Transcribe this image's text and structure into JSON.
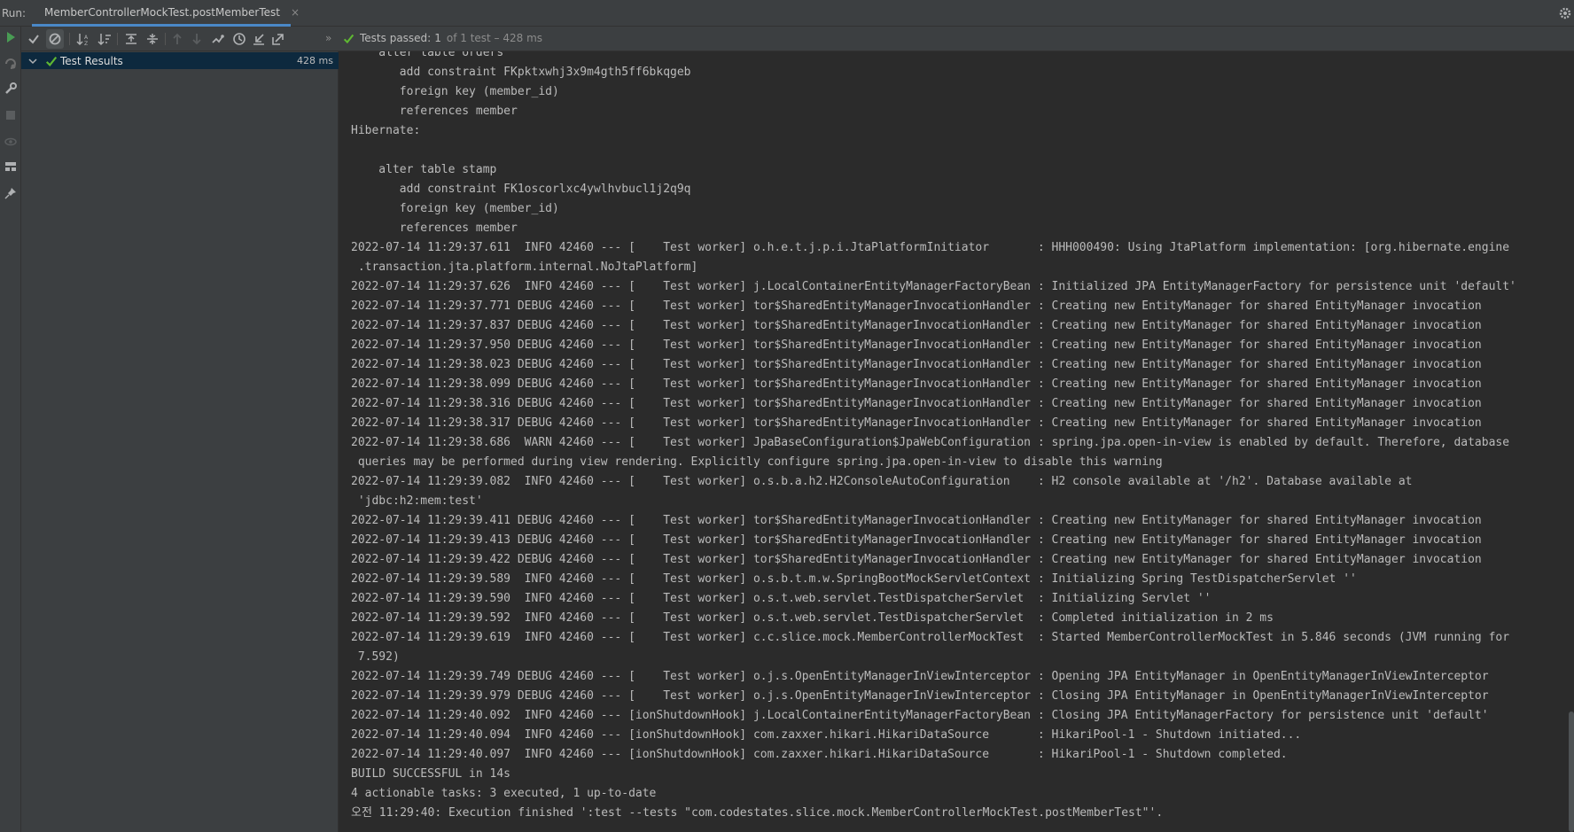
{
  "titlebar": {
    "run_label": "Run:",
    "tab_title": "MemberControllerMockTest.postMemberTest",
    "tab_close": "×"
  },
  "status": {
    "passed_label": "Tests passed:",
    "passed_count": "1",
    "of_text": "of 1 test – 428 ms"
  },
  "tree": {
    "root_label": "Test Results",
    "root_time": "428 ms"
  },
  "toolbar": {
    "more": "»"
  },
  "console": {
    "lines": [
      "    alter table orders",
      "       add constraint FKpktxwhj3x9m4gth5ff6bkqgeb",
      "       foreign key (member_id)",
      "       references member",
      "Hibernate: ",
      "",
      "    alter table stamp",
      "       add constraint FK1oscorlxc4ywlhvbucl1j2q9q",
      "       foreign key (member_id)",
      "       references member",
      "2022-07-14 11:29:37.611  INFO 42460 --- [    Test worker] o.h.e.t.j.p.i.JtaPlatformInitiator       : HHH000490: Using JtaPlatform implementation: [org.hibernate.engine",
      " .transaction.jta.platform.internal.NoJtaPlatform]",
      "2022-07-14 11:29:37.626  INFO 42460 --- [    Test worker] j.LocalContainerEntityManagerFactoryBean : Initialized JPA EntityManagerFactory for persistence unit 'default'",
      "2022-07-14 11:29:37.771 DEBUG 42460 --- [    Test worker] tor$SharedEntityManagerInvocationHandler : Creating new EntityManager for shared EntityManager invocation",
      "2022-07-14 11:29:37.837 DEBUG 42460 --- [    Test worker] tor$SharedEntityManagerInvocationHandler : Creating new EntityManager for shared EntityManager invocation",
      "2022-07-14 11:29:37.950 DEBUG 42460 --- [    Test worker] tor$SharedEntityManagerInvocationHandler : Creating new EntityManager for shared EntityManager invocation",
      "2022-07-14 11:29:38.023 DEBUG 42460 --- [    Test worker] tor$SharedEntityManagerInvocationHandler : Creating new EntityManager for shared EntityManager invocation",
      "2022-07-14 11:29:38.099 DEBUG 42460 --- [    Test worker] tor$SharedEntityManagerInvocationHandler : Creating new EntityManager for shared EntityManager invocation",
      "2022-07-14 11:29:38.316 DEBUG 42460 --- [    Test worker] tor$SharedEntityManagerInvocationHandler : Creating new EntityManager for shared EntityManager invocation",
      "2022-07-14 11:29:38.317 DEBUG 42460 --- [    Test worker] tor$SharedEntityManagerInvocationHandler : Creating new EntityManager for shared EntityManager invocation",
      "2022-07-14 11:29:38.686  WARN 42460 --- [    Test worker] JpaBaseConfiguration$JpaWebConfiguration : spring.jpa.open-in-view is enabled by default. Therefore, database",
      " queries may be performed during view rendering. Explicitly configure spring.jpa.open-in-view to disable this warning",
      "2022-07-14 11:29:39.082  INFO 42460 --- [    Test worker] o.s.b.a.h2.H2ConsoleAutoConfiguration    : H2 console available at '/h2'. Database available at",
      " 'jdbc:h2:mem:test'",
      "2022-07-14 11:29:39.411 DEBUG 42460 --- [    Test worker] tor$SharedEntityManagerInvocationHandler : Creating new EntityManager for shared EntityManager invocation",
      "2022-07-14 11:29:39.413 DEBUG 42460 --- [    Test worker] tor$SharedEntityManagerInvocationHandler : Creating new EntityManager for shared EntityManager invocation",
      "2022-07-14 11:29:39.422 DEBUG 42460 --- [    Test worker] tor$SharedEntityManagerInvocationHandler : Creating new EntityManager for shared EntityManager invocation",
      "2022-07-14 11:29:39.589  INFO 42460 --- [    Test worker] o.s.b.t.m.w.SpringBootMockServletContext : Initializing Spring TestDispatcherServlet ''",
      "2022-07-14 11:29:39.590  INFO 42460 --- [    Test worker] o.s.t.web.servlet.TestDispatcherServlet  : Initializing Servlet ''",
      "2022-07-14 11:29:39.592  INFO 42460 --- [    Test worker] o.s.t.web.servlet.TestDispatcherServlet  : Completed initialization in 2 ms",
      "2022-07-14 11:29:39.619  INFO 42460 --- [    Test worker] c.c.slice.mock.MemberControllerMockTest  : Started MemberControllerMockTest in 5.846 seconds (JVM running for",
      " 7.592)",
      "2022-07-14 11:29:39.749 DEBUG 42460 --- [    Test worker] o.j.s.OpenEntityManagerInViewInterceptor : Opening JPA EntityManager in OpenEntityManagerInViewInterceptor",
      "2022-07-14 11:29:39.979 DEBUG 42460 --- [    Test worker] o.j.s.OpenEntityManagerInViewInterceptor : Closing JPA EntityManager in OpenEntityManagerInViewInterceptor",
      "2022-07-14 11:29:40.092  INFO 42460 --- [ionShutdownHook] j.LocalContainerEntityManagerFactoryBean : Closing JPA EntityManagerFactory for persistence unit 'default'",
      "2022-07-14 11:29:40.094  INFO 42460 --- [ionShutdownHook] com.zaxxer.hikari.HikariDataSource       : HikariPool-1 - Shutdown initiated...",
      "2022-07-14 11:29:40.097  INFO 42460 --- [ionShutdownHook] com.zaxxer.hikari.HikariDataSource       : HikariPool-1 - Shutdown completed.",
      "BUILD SUCCESSFUL in 14s",
      "4 actionable tasks: 3 executed, 1 up-to-date",
      "오전 11:29:40: Execution finished ':test --tests \"com.codestates.slice.mock.MemberControllerMockTest.postMemberTest\"'."
    ]
  },
  "colors": {
    "pass_green": "#5fb832",
    "run_green": "#499c54",
    "selection": "#0d293e",
    "tab_underline": "#4a88c7"
  },
  "icons": {
    "tab": "test-runner-icon",
    "gear": "gear-icon",
    "left_bar": [
      "rerun-icon",
      "rerun-failed-icon",
      "wrench-icon",
      "stop-icon",
      "eye-icon",
      "layout-icon",
      "pin-icon"
    ],
    "toolbar": [
      "show-passed-icon",
      "show-ignored-icon",
      "sort-alpha-icon",
      "sort-duration-icon",
      "expand-all-icon",
      "collapse-all-icon",
      "previous-failed-icon",
      "next-failed-icon",
      "test-history-icon",
      "clock-icon",
      "import-tests-icon",
      "export-tests-icon"
    ]
  }
}
